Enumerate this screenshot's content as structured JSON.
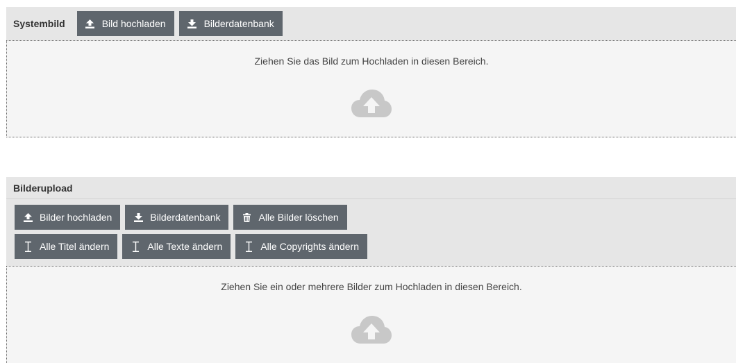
{
  "systembild": {
    "title": "Systembild",
    "buttons": {
      "upload_label": "Bild hochladen",
      "database_label": "Bilderdatenbank"
    },
    "drop_text": "Ziehen Sie das Bild zum Hochladen in diesen Bereich."
  },
  "bilderupload": {
    "title": "Bilderupload",
    "buttons_row1": {
      "upload_label": "Bilder hochladen",
      "database_label": "Bilderdatenbank",
      "delete_all_label": "Alle Bilder löschen"
    },
    "buttons_row2": {
      "titles_label": "Alle Titel ändern",
      "texts_label": "Alle Texte ändern",
      "copyrights_label": "Alle Copyrights ändern"
    },
    "drop_text": "Ziehen Sie ein oder mehrere Bilder zum Hochladen in diesen Bereich."
  },
  "icons": {
    "upload": "upload-icon",
    "download": "download-icon",
    "trash": "trash-icon",
    "text_cursor": "text-cursor-icon",
    "cloud_upload": "cloud-upload-icon"
  },
  "colors": {
    "button_bg": "#5f666d",
    "header_bg": "#e6e6e6",
    "dropzone_bg": "#f5f5f5",
    "cloud_icon": "#c8c8c8"
  }
}
